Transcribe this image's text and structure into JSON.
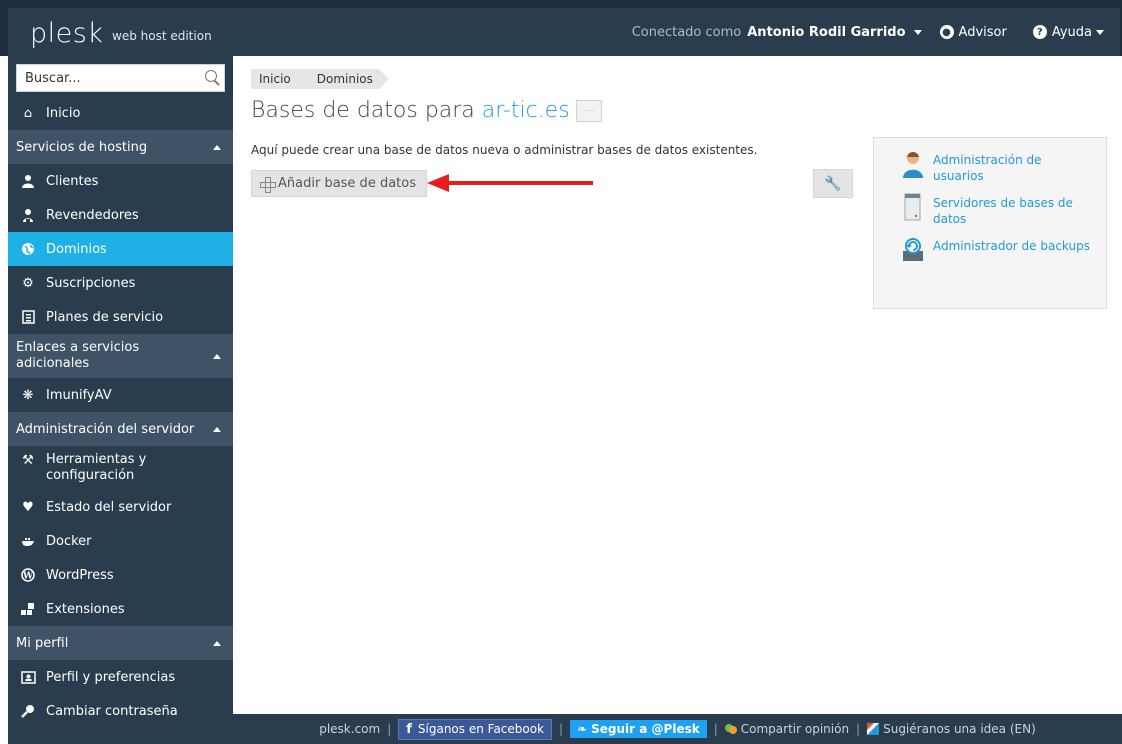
{
  "topbar": {
    "logo": "plesk",
    "edition": "web host edition",
    "connected_label": "Conectado como",
    "user_name": "Antonio Rodil Garrido",
    "advisor_label": "Advisor",
    "help_label": "Ayuda"
  },
  "sidebar": {
    "search_placeholder": "Buscar...",
    "home": "Inicio",
    "sections": {
      "hosting": "Servicios de hosting",
      "links": "Enlaces a servicios adicionales",
      "server_admin": "Administración del servidor",
      "profile": "Mi perfil"
    },
    "items": {
      "clients": "Clientes",
      "resellers": "Revendedores",
      "domains": "Dominios",
      "subscriptions": "Suscripciones",
      "service_plans": "Planes de servicio",
      "imunify": "ImunifyAV",
      "tools": "Herramientas y configuración",
      "server_status": "Estado del servidor",
      "docker": "Docker",
      "wordpress": "WordPress",
      "extensions": "Extensiones",
      "profile_prefs": "Perfil y preferencias",
      "change_password": "Cambiar contraseña"
    }
  },
  "main": {
    "breadcrumb": [
      "Inicio",
      "Dominios"
    ],
    "title_prefix": "Bases de datos para",
    "title_domain": "ar-tic.es",
    "more_label": "···",
    "description": "Aquí puede crear una base de datos nueva o administrar bases de datos existentes.",
    "add_button": "Añadir base de datos",
    "side_links": [
      "Administración de usuarios",
      "Servidores de bases de datos",
      "Administrador de backups"
    ]
  },
  "footer": {
    "site": "plesk.com",
    "facebook": "Síganos en Facebook",
    "twitter": "Seguir a @Plesk",
    "feedback": "Compartir opinión",
    "idea": "Sugiéranos una idea (EN)"
  },
  "colors": {
    "sidebar_bg": "#2a3d4f",
    "section_bg": "#3e5366",
    "active_item": "#1fb1e5",
    "link": "#1f9ad6",
    "arrow": "#e81e1e"
  }
}
